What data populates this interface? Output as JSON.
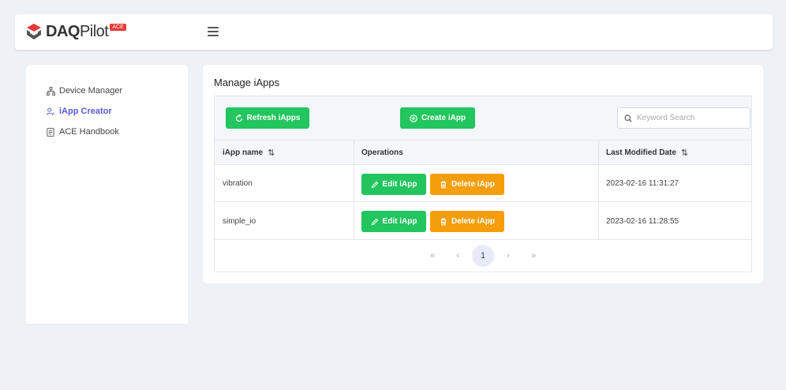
{
  "brand": {
    "name_bold": "DAQ",
    "name_light": "Pilot",
    "badge": "ACE",
    "accent": "#e53935"
  },
  "sidebar": {
    "items": [
      {
        "label": "Device Manager",
        "icon": "sitemap-icon",
        "active": false
      },
      {
        "label": "iApp Creator",
        "icon": "user-edit-icon",
        "active": true
      },
      {
        "label": "ACE Handbook",
        "icon": "book-icon",
        "active": false
      }
    ],
    "active_color": "#5b5bd6"
  },
  "main": {
    "title": "Manage iApps",
    "refresh_label": "Refresh iApps",
    "create_label": "Create iApp",
    "search_placeholder": "Keyword Search",
    "search_value": "",
    "columns": [
      "iApp name",
      "Operations",
      "Last Modified Date"
    ],
    "rows": [
      {
        "name": "vibration",
        "edit": "Edit iApp",
        "delete": "Delete iApp",
        "modified": "2023-02-16 11:31:27"
      },
      {
        "name": "simple_io",
        "edit": "Edit iApp",
        "delete": "Delete iApp",
        "modified": "2023-02-16 11:28:55"
      }
    ],
    "pagination": {
      "first": "«",
      "prev": "‹",
      "current": "1",
      "next": "›",
      "last": "»"
    },
    "colors": {
      "green": "#22c55e",
      "orange": "#f59e0b"
    }
  }
}
